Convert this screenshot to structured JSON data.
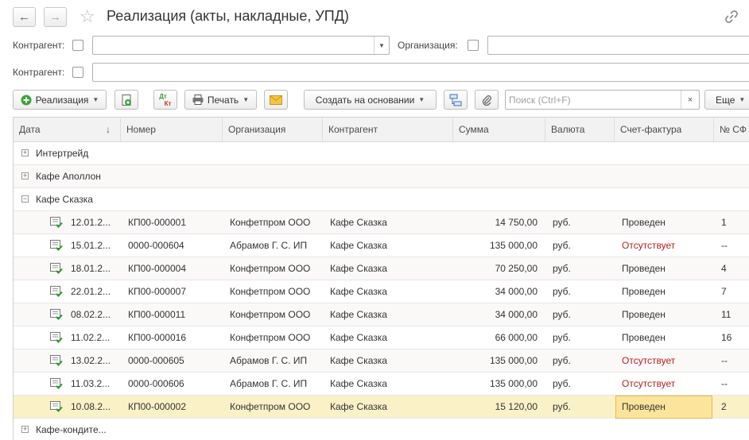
{
  "window": {
    "title": "Реализация (акты, накладные, УПД)"
  },
  "nav": {
    "back": "←",
    "forward": "→"
  },
  "filters": {
    "counterparty_label": "Контрагент:",
    "organization_label": "Организация:",
    "counterparty2_label": "Контрагент:"
  },
  "toolbar": {
    "realization": "Реализация",
    "print": "Печать",
    "create_based": "Создать на основании",
    "search_placeholder": "Поиск (Ctrl+F)",
    "clear": "×",
    "more": "Еще",
    "dtkt_top": "Дт",
    "dtkt_bottom": "Кт"
  },
  "table": {
    "columns": [
      "Дата",
      "Номер",
      "Организация",
      "Контрагент",
      "Сумма",
      "Валюта",
      "Счет-фактура",
      "№ СФ"
    ],
    "groups": {
      "g1": "Интертрейд",
      "g2": "Кафе Аполлон",
      "g3": "Кафе Сказка",
      "g4": "Кафе-кондите..."
    },
    "rows": [
      {
        "date": "12.01.2...",
        "number": "КП00-000001",
        "org": "Конфетпром ООО",
        "counterparty": "Кафе Сказка",
        "sum": "14 750,00",
        "currency": "руб.",
        "invoice": "Проведен",
        "sf": "1"
      },
      {
        "date": "15.01.2...",
        "number": "0000-000604",
        "org": "Абрамов Г. С. ИП",
        "counterparty": "Кафе Сказка",
        "sum": "135 000,00",
        "currency": "руб.",
        "invoice": "Отсутствует",
        "sf": "--"
      },
      {
        "date": "18.01.2...",
        "number": "КП00-000004",
        "org": "Конфетпром ООО",
        "counterparty": "Кафе Сказка",
        "sum": "70 250,00",
        "currency": "руб.",
        "invoice": "Проведен",
        "sf": "4"
      },
      {
        "date": "22.01.2...",
        "number": "КП00-000007",
        "org": "Конфетпром ООО",
        "counterparty": "Кафе Сказка",
        "sum": "34 000,00",
        "currency": "руб.",
        "invoice": "Проведен",
        "sf": "7"
      },
      {
        "date": "08.02.2...",
        "number": "КП00-000011",
        "org": "Конфетпром ООО",
        "counterparty": "Кафе Сказка",
        "sum": "34 000,00",
        "currency": "руб.",
        "invoice": "Проведен",
        "sf": "11"
      },
      {
        "date": "11.02.2...",
        "number": "КП00-000016",
        "org": "Конфетпром ООО",
        "counterparty": "Кафе Сказка",
        "sum": "66 000,00",
        "currency": "руб.",
        "invoice": "Проведен",
        "sf": "16"
      },
      {
        "date": "13.02.2...",
        "number": "0000-000605",
        "org": "Абрамов Г. С. ИП",
        "counterparty": "Кафе Сказка",
        "sum": "135 000,00",
        "currency": "руб.",
        "invoice": "Отсутствует",
        "sf": "--"
      },
      {
        "date": "11.03.2...",
        "number": "0000-000606",
        "org": "Абрамов Г. С. ИП",
        "counterparty": "Кафе Сказка",
        "sum": "135 000,00",
        "currency": "руб.",
        "invoice": "Отсутствует",
        "sf": "--"
      },
      {
        "date": "10.08.2...",
        "number": "КП00-000002",
        "org": "Конфетпром ООО",
        "counterparty": "Кафе Сказка",
        "sum": "15 120,00",
        "currency": "руб.",
        "invoice": "Проведен",
        "sf": "2"
      }
    ]
  },
  "colors": {
    "accent_green": "#3aa53a",
    "status_missing": "#b22222",
    "selected_row": "#fbf1c7"
  }
}
